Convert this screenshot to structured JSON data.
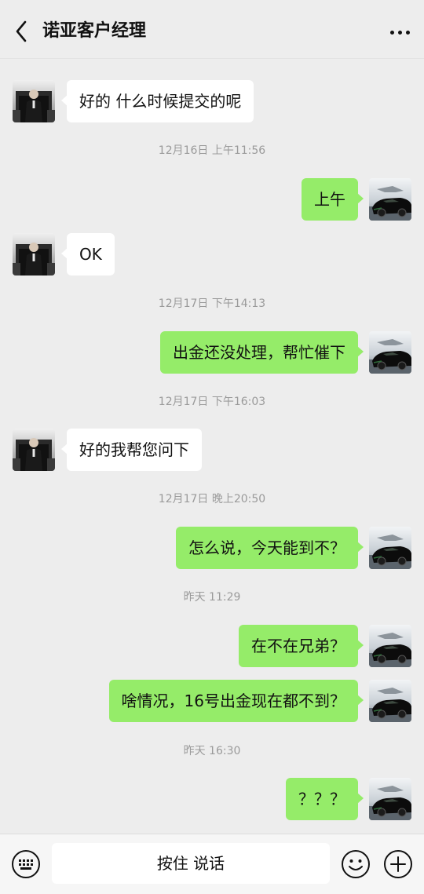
{
  "header": {
    "title": "诺亚客户经理",
    "back_icon": "chevron-left-icon",
    "more_icon": "more-dots-icon"
  },
  "messages": [
    {
      "type": "time",
      "text": "12月16日 上午11:56"
    },
    {
      "type": "in",
      "text": "好的 什么时候提交的呢"
    },
    {
      "type": "out",
      "text": "上午"
    },
    {
      "type": "in",
      "text": "OK"
    },
    {
      "type": "time",
      "text": "12月17日 下午14:13"
    },
    {
      "type": "out",
      "text": "出金还没处理，帮忙催下"
    },
    {
      "type": "time",
      "text": "12月17日 下午16:03"
    },
    {
      "type": "in",
      "text": "好的我帮您问下"
    },
    {
      "type": "time",
      "text": "12月17日 晚上20:50"
    },
    {
      "type": "out",
      "text": "怎么说，今天能到不？"
    },
    {
      "type": "time",
      "text": "昨天 11:29"
    },
    {
      "type": "out",
      "text": "在不在兄弟？"
    },
    {
      "type": "out",
      "text": "啥情况，16号出金现在都不到？"
    },
    {
      "type": "time",
      "text": "昨天 16:30"
    },
    {
      "type": "out",
      "text": "？？？"
    }
  ],
  "footer": {
    "voice_label": "按住 说话",
    "keyboard_icon": "keyboard-icon",
    "emoji_icon": "emoji-icon",
    "plus_icon": "plus-icon"
  },
  "colors": {
    "background": "#ededed",
    "outgoing_bubble": "#95ec69",
    "incoming_bubble": "#ffffff",
    "timestamp": "#9a9a9a"
  }
}
